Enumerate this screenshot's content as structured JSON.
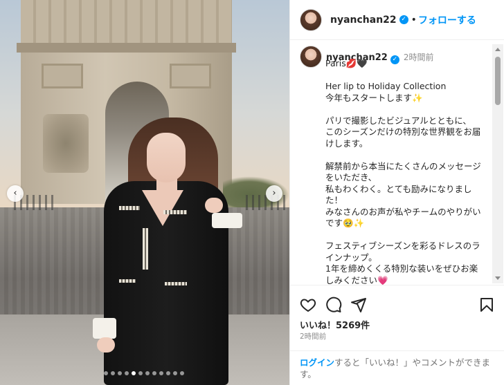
{
  "post": {
    "username": "nyanchan22",
    "verified_badge": "✓",
    "separator": "•",
    "follow_label": "フォローする",
    "caption_time": "2時間前",
    "caption": "Paris💋🖤\n\nHer lip to Holiday Collection\n今年もスタートします✨\n\nパリで撮影したビジュアルとともに、\nこのシーズンだけの特別な世界観をお届けします。\n\n解禁前から本当にたくさんのメッセージをいただき、\n私もわくわく。とても励みになりました！\nみなさんのお声が私やチームのやりがいです🥹✨\n\nフェスティブシーズンを彩るドレスのラインナップ。\n1年を締めくくる特別な装いをぜひお楽しみください💗",
    "likes": "いいね！5269件",
    "posted_time": "2時間前",
    "login_link": "ログイン",
    "login_rest": "すると「いいね！」やコメントができます。"
  },
  "carousel": {
    "prev": "‹",
    "next": "›",
    "dot_count": 12,
    "active_dot": 4
  },
  "icons": {
    "like": "heart-icon",
    "comment": "comment-icon",
    "share": "share-icon",
    "save": "bookmark-icon"
  },
  "colors": {
    "accent": "#0095f6",
    "text": "#262626",
    "muted": "#8e8e8e"
  }
}
